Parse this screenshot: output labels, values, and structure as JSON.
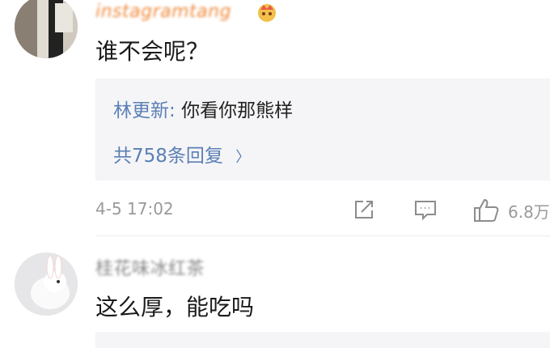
{
  "comments": [
    {
      "username": "instagramtang",
      "text": "谁不会呢？",
      "reply_preview": {
        "author": "林更新",
        "separator": ": ",
        "text": "你看你那熊样",
        "more_label": "共758条回复",
        "more_chevron": "〉"
      },
      "timestamp": "4-5 17:02",
      "likes": "6.8万"
    },
    {
      "username": "桂花味冰红茶",
      "text": "这么厚，能吃吗"
    }
  ],
  "icons": {
    "share": "share-icon",
    "comment": "comment-icon",
    "like": "thumbs-up-icon"
  },
  "colors": {
    "link_blue": "#5b7fb5",
    "username_orange": "#f08a3c",
    "meta_gray": "#9a9a9a",
    "reply_bg": "#f5f5f7"
  }
}
